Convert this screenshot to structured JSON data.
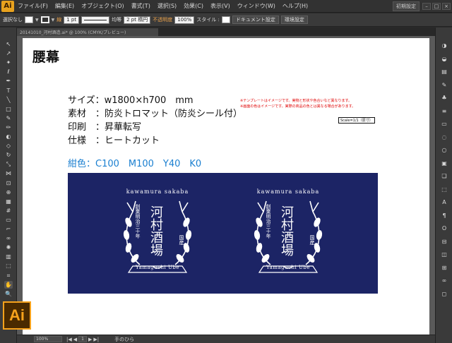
{
  "app": {
    "logo": "Ai",
    "menus": [
      "ファイル(F)",
      "編集(E)",
      "オブジェクト(O)",
      "書式(T)",
      "選択(S)",
      "効果(C)",
      "表示(V)",
      "ウィンドウ(W)",
      "ヘルプ(H)"
    ],
    "workspace": "初期設定",
    "window_controls": [
      "–",
      "□",
      "×"
    ]
  },
  "control_bar": {
    "selection_label": "選択なし",
    "stroke_label": "線",
    "stroke_width": "1 pt",
    "profile_label": "均等",
    "brush_label": "2 pt 楕円",
    "opacity_label": "不透明度",
    "opacity_value": "100%",
    "style_label": "スタイル :",
    "doc_settings_button": "ドキュメント設定",
    "preferences_button": "環境設定"
  },
  "document_tab": {
    "label": "20141010_河村酒造.ai* @ 100% (CMYK/プレビュー)"
  },
  "artboard": {
    "title": "腰幕",
    "specs": [
      "サイズ：w1800×h700　mm",
      "素材　：防炎トロマット（防炎シール付）",
      "印刷　：昇華転写",
      "仕様　：ヒートカット"
    ],
    "notes": [
      "※テンプレートはイメージです。実物と形状や色合いなど異なります。",
      "※画面の色はイメージです。実際の商品の色とは異なる場合があります。"
    ],
    "scale": "Scale=1/1（原寸）",
    "color_line": "紺色：C100　M100　Y40　K0",
    "banner_color": "#1c2465",
    "emblem": {
      "top_text": "kawamura sakaba",
      "name": "河村酒場",
      "established": "創業明治三十年",
      "origin": "国産",
      "bottom_text": "Yamaguchi Ube"
    }
  },
  "status_bar": {
    "zoom": "100%",
    "page": "1",
    "tool_name": "手のひら"
  },
  "tools": [
    {
      "name": "selection-tool",
      "glyph": "↖"
    },
    {
      "name": "direct-selection-tool",
      "glyph": "↗"
    },
    {
      "name": "magic-wand-tool",
      "glyph": "✦"
    },
    {
      "name": "lasso-tool",
      "glyph": "ℓ"
    },
    {
      "name": "pen-tool",
      "glyph": "✒"
    },
    {
      "name": "type-tool",
      "glyph": "T"
    },
    {
      "name": "line-tool",
      "glyph": "╲"
    },
    {
      "name": "rectangle-tool",
      "glyph": "□"
    },
    {
      "name": "paintbrush-tool",
      "glyph": "✎"
    },
    {
      "name": "pencil-tool",
      "glyph": "✏"
    },
    {
      "name": "blob-brush-tool",
      "glyph": "◐"
    },
    {
      "name": "eraser-tool",
      "glyph": "◇"
    },
    {
      "name": "rotate-tool",
      "glyph": "↻"
    },
    {
      "name": "scale-tool",
      "glyph": "⤡"
    },
    {
      "name": "width-tool",
      "glyph": "⋈"
    },
    {
      "name": "free-transform-tool",
      "glyph": "⊡"
    },
    {
      "name": "shape-builder-tool",
      "glyph": "⊕"
    },
    {
      "name": "perspective-grid-tool",
      "glyph": "▦"
    },
    {
      "name": "mesh-tool",
      "glyph": "#"
    },
    {
      "name": "gradient-tool",
      "glyph": "▭"
    },
    {
      "name": "eyedropper-tool",
      "glyph": "⌐"
    },
    {
      "name": "blend-tool",
      "glyph": "∞"
    },
    {
      "name": "symbol-sprayer-tool",
      "glyph": "✺"
    },
    {
      "name": "column-graph-tool",
      "glyph": "▥"
    },
    {
      "name": "artboard-tool",
      "glyph": "⬚"
    },
    {
      "name": "slice-tool",
      "glyph": "⌗"
    },
    {
      "name": "hand-tool",
      "glyph": "✋"
    },
    {
      "name": "zoom-tool",
      "glyph": "🔍"
    }
  ],
  "dock_icons": [
    {
      "name": "color-panel-icon",
      "glyph": "◑"
    },
    {
      "name": "color-guide-icon",
      "glyph": "◒"
    },
    {
      "name": "swatches-icon",
      "glyph": "▤"
    },
    {
      "name": "brushes-icon",
      "glyph": "✎"
    },
    {
      "name": "symbols-icon",
      "glyph": "♣"
    },
    {
      "name": "stroke-icon",
      "glyph": "≡"
    },
    {
      "name": "gradient-icon",
      "glyph": "▭"
    },
    {
      "name": "transparency-icon",
      "glyph": "◌"
    },
    {
      "name": "appearance-icon",
      "glyph": "○"
    },
    {
      "name": "graphic-styles-icon",
      "glyph": "▣"
    },
    {
      "name": "layers-icon",
      "glyph": "❏"
    },
    {
      "name": "artboards-icon",
      "glyph": "⬚"
    },
    {
      "name": "character-icon",
      "glyph": "A"
    },
    {
      "name": "paragraph-icon",
      "glyph": "¶"
    },
    {
      "name": "opentype-icon",
      "glyph": "O"
    },
    {
      "name": "align-icon",
      "glyph": "⊟"
    },
    {
      "name": "pathfinder-icon",
      "glyph": "◫"
    },
    {
      "name": "transform-icon",
      "glyph": "⊞"
    },
    {
      "name": "links-icon",
      "glyph": "∞"
    },
    {
      "name": "navigator-icon",
      "glyph": "◻"
    }
  ]
}
